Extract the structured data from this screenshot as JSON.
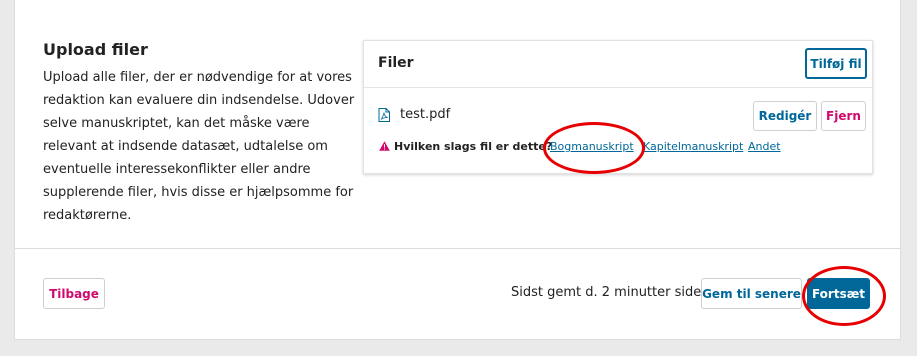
{
  "section": {
    "title": "Upload filer",
    "description": "Upload alle filer, der er nødvendige for at vores redaktion kan evaluere din indsendelse. Udover selve manuskriptet, kan det måske være relevant at indsende datasæt, udtalelse om eventuelle interessekonflikter eller andre supplerende filer, hvis disse er hjælpsomme for redaktørerne."
  },
  "files_panel": {
    "title": "Filer",
    "add_button": "Tilføj fil",
    "file": {
      "icon": "pdf-file-icon",
      "name": "test.pdf",
      "edit_button": "Redigér",
      "remove_button": "Fjern"
    },
    "file_type": {
      "icon": "warning-icon",
      "question": "Hvilken slags fil er dette?",
      "options": [
        "Bogmanuskript",
        "Kapitelmanuskript",
        "Andet"
      ]
    }
  },
  "footer": {
    "back_button": "Tilbage",
    "save_status": "Sidst gemt d. 2 minutter siden",
    "save_later_button": "Gem til senere",
    "continue_button": "Fortsæt"
  },
  "colors": {
    "primary": "#006798",
    "danger": "#d00a6c",
    "annotation": "#e60000"
  }
}
